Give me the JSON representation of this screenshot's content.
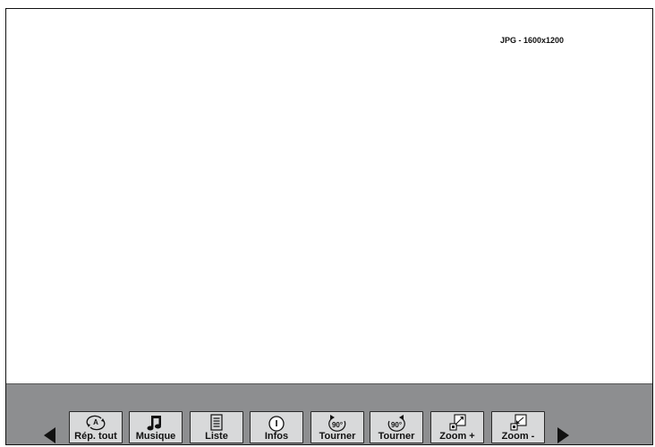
{
  "viewer": {
    "image_info": "JPG - 1600x1200"
  },
  "toolbar": {
    "buttons": [
      {
        "label": "Rép. tout",
        "icon": "repeat-all-icon"
      },
      {
        "label": "Musique",
        "icon": "music-note-icon"
      },
      {
        "label": "Liste",
        "icon": "list-icon"
      },
      {
        "label": "Infos",
        "icon": "info-icon"
      },
      {
        "label": "Tourner",
        "icon": "rotate-left-90-icon",
        "icon_text": "90°"
      },
      {
        "label": "Tourner",
        "icon": "rotate-right-90-icon",
        "icon_text": "90°"
      },
      {
        "label": "Zoom +",
        "icon": "zoom-in-icon"
      },
      {
        "label": "Zoom -",
        "icon": "zoom-out-icon"
      }
    ],
    "prev_icon": "triangle-left-icon",
    "next_icon": "triangle-right-icon"
  }
}
